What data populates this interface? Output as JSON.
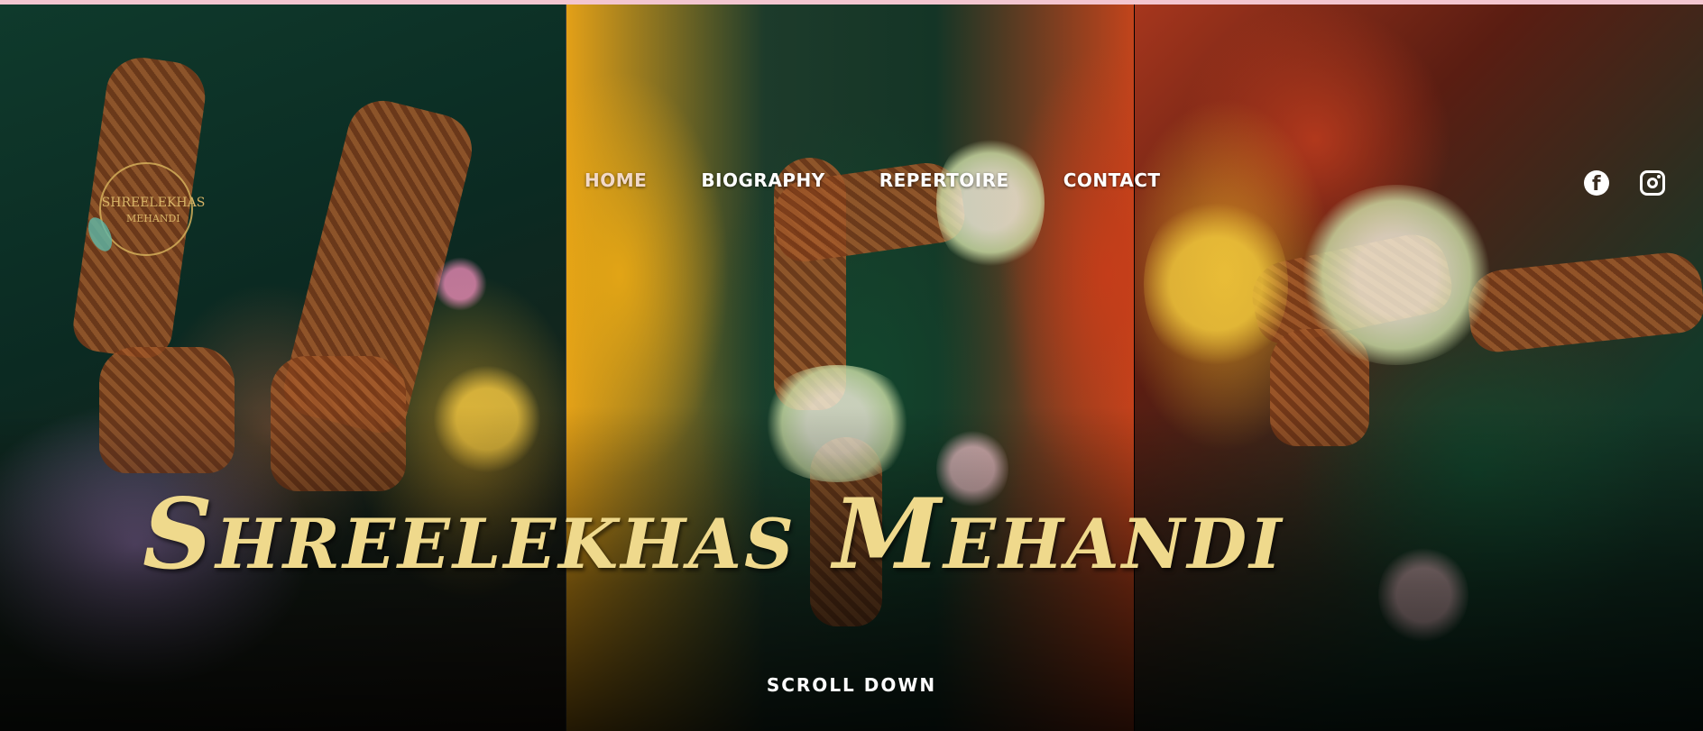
{
  "logo": {
    "line1": "SHREELEKHAS",
    "line2": "MEHANDI"
  },
  "nav": {
    "items": [
      {
        "label": "HOME"
      },
      {
        "label": "BIOGRAPHY"
      },
      {
        "label": "REPERTOIRE"
      },
      {
        "label": "CONTACT"
      }
    ]
  },
  "social": {
    "facebook_icon": "facebook-icon",
    "instagram_icon": "instagram-icon"
  },
  "hero": {
    "title": "Shreelekhas Mehandi",
    "scroll_label": "SCROLL DOWN"
  },
  "colors": {
    "title": "#efd98c",
    "nav": "#ffffff",
    "logo_gold": "#d8b467"
  }
}
